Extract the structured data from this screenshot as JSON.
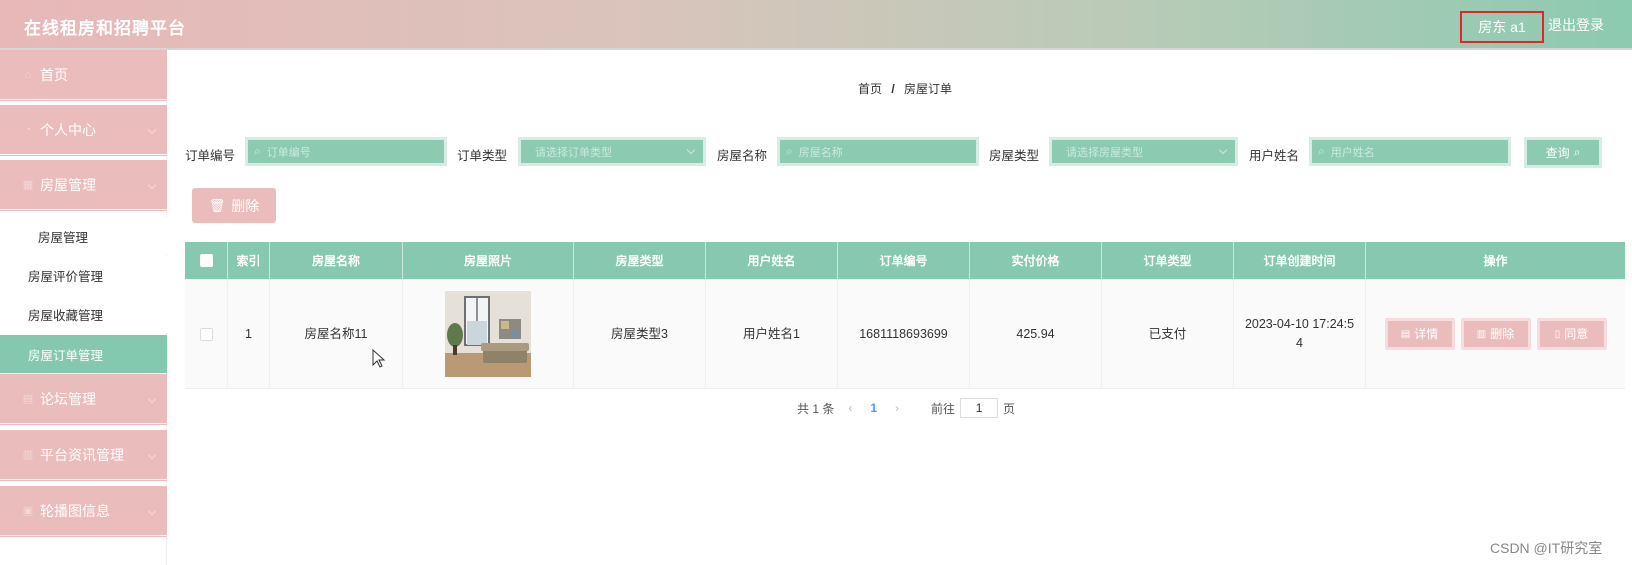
{
  "header": {
    "title": "在线租房和招聘平台",
    "user": "房东 a1",
    "logout": "退出登录"
  },
  "sidebar": {
    "items": [
      {
        "label": "首页",
        "icon": "home-icon"
      },
      {
        "label": "个人中心",
        "icon": "user-icon"
      },
      {
        "label": "房屋管理",
        "icon": "house-icon"
      },
      {
        "label": "论坛管理",
        "icon": "forum-icon"
      },
      {
        "label": "平台资讯管理",
        "icon": "news-icon"
      },
      {
        "label": "轮播图信息",
        "icon": "carousel-icon"
      }
    ],
    "sub_items": [
      {
        "label": "房屋管理"
      },
      {
        "label": "房屋评价管理"
      },
      {
        "label": "房屋收藏管理"
      },
      {
        "label": "房屋订单管理",
        "active": true
      }
    ]
  },
  "breadcrumb": {
    "home": "首页",
    "sep": "/",
    "current": "房屋订单"
  },
  "filters": {
    "order_no": {
      "label": "订单编号",
      "placeholder": "订单编号"
    },
    "order_type": {
      "label": "订单类型",
      "placeholder": "请选择订单类型"
    },
    "house_name": {
      "label": "房屋名称",
      "placeholder": "房屋名称"
    },
    "house_type": {
      "label": "房屋类型",
      "placeholder": "请选择房屋类型"
    },
    "user_name": {
      "label": "用户姓名",
      "placeholder": "用户姓名"
    },
    "query_button": "查询"
  },
  "toolbar": {
    "delete_label": "删除"
  },
  "table": {
    "headers": [
      "索引",
      "房屋名称",
      "房屋照片",
      "房屋类型",
      "用户姓名",
      "订单编号",
      "实付价格",
      "订单类型",
      "订单创建时间",
      "操作"
    ],
    "rows": [
      {
        "index": "1",
        "house_name": "房屋名称11",
        "house_type": "房屋类型3",
        "user_name": "用户姓名1",
        "order_no": "1681118693699",
        "price": "425.94",
        "order_type": "已支付",
        "created_line1": "2023-04-10 17:24:5",
        "created_line2": "4",
        "actions": {
          "detail": "详情",
          "delete": "删除",
          "agree": "同意"
        }
      }
    ]
  },
  "pagination": {
    "total": "共 1 条",
    "current_page": "1",
    "goto": "前往",
    "goto_value": "1",
    "page_unit": "页"
  },
  "watermark": "CSDN @IT研究室",
  "colors": {
    "pink": "#ebbcbc",
    "green": "#87c8b0",
    "active": "#85c8b0"
  }
}
